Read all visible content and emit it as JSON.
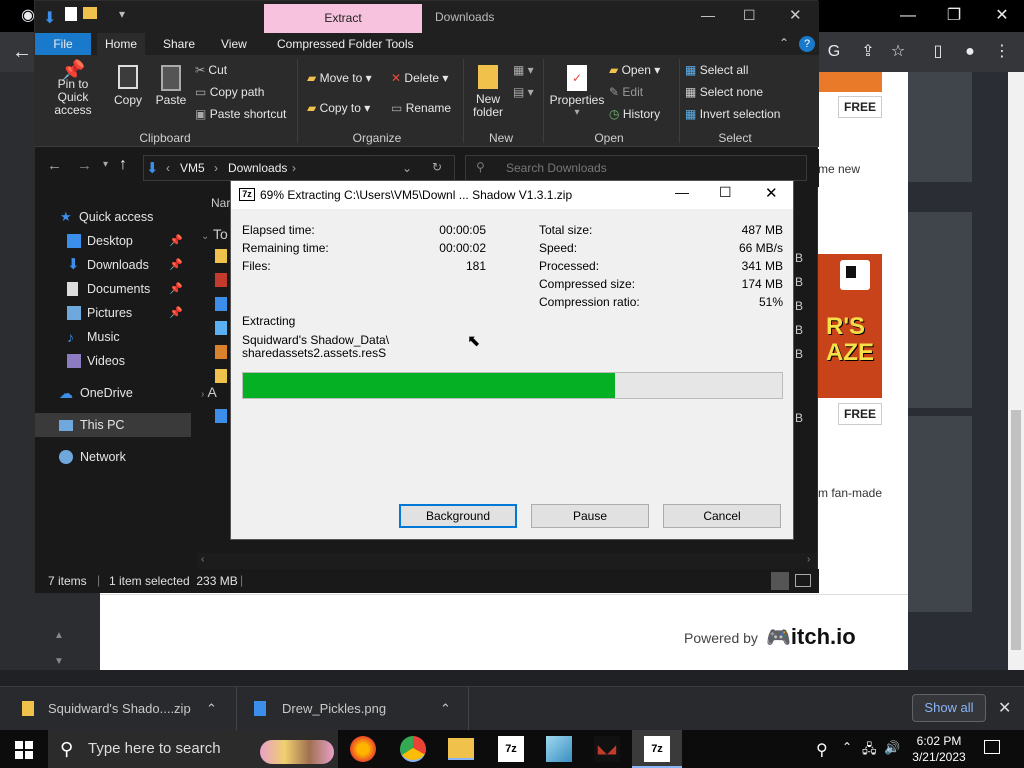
{
  "chrome": {
    "webpage": {
      "free_badge_1": "FREE",
      "free_badge_2": "FREE",
      "snippet_1": "me new",
      "snippet_2": "m fan-made",
      "game_title_art": "R'S\nAZE",
      "powered_by": "Powered by",
      "brand": "itch.io"
    }
  },
  "explorer": {
    "title_tab": "Extract",
    "title_location": "Downloads",
    "menu": [
      "File",
      "Home",
      "Share",
      "View",
      "Compressed Folder Tools"
    ],
    "ribbon": {
      "pin_label": "Pin to Quick access",
      "copy_label": "Copy",
      "paste_label": "Paste",
      "cut_label": "Cut",
      "copy_path_label": "Copy path",
      "paste_shortcut_label": "Paste shortcut",
      "move_to_label": "Move to",
      "copy_to_label": "Copy to",
      "delete_label": "Delete",
      "rename_label": "Rename",
      "new_folder_label": "New folder",
      "properties_label": "Properties",
      "open_label": "Open",
      "edit_label": "Edit",
      "history_label": "History",
      "select_all_label": "Select all",
      "select_none_label": "Select none",
      "invert_selection_label": "Invert selection",
      "groups": [
        "Clipboard",
        "Organize",
        "New",
        "Open",
        "Select"
      ]
    },
    "address": {
      "crumbs": [
        "VM5",
        "Downloads"
      ],
      "search_placeholder": "Search Downloads"
    },
    "nav": {
      "quick_access": "Quick access",
      "items": [
        {
          "label": "Desktop",
          "icon": "desktop-icon",
          "pinned": true
        },
        {
          "label": "Downloads",
          "icon": "download-icon",
          "pinned": true
        },
        {
          "label": "Documents",
          "icon": "documents-icon",
          "pinned": true
        },
        {
          "label": "Pictures",
          "icon": "pictures-icon",
          "pinned": true
        },
        {
          "label": "Music",
          "icon": "music-icon",
          "pinned": false
        },
        {
          "label": "Videos",
          "icon": "videos-icon",
          "pinned": false
        }
      ],
      "onedrive": "OneDrive",
      "this_pc": "This PC",
      "network": "Network"
    },
    "content_peek": {
      "col_header": "Nar",
      "group_1": "To",
      "group_2": "A",
      "size_suffix": "B"
    },
    "status": {
      "items_count": "7 items",
      "selection": "1 item selected  233 MB"
    }
  },
  "dialog": {
    "title": "69% Extracting C:\\Users\\VM5\\Downl ... Shadow V1.3.1.zip",
    "icon_text": "7z",
    "left_stats": [
      {
        "label": "Elapsed time:",
        "value": "00:00:05"
      },
      {
        "label": "Remaining time:",
        "value": "00:00:02"
      },
      {
        "label": "Files:",
        "value": "181"
      }
    ],
    "right_stats": [
      {
        "label": "Total size:",
        "value": "487 MB"
      },
      {
        "label": "Speed:",
        "value": "66 MB/s"
      },
      {
        "label": "Processed:",
        "value": "341 MB"
      },
      {
        "label": "Compressed size:",
        "value": "174 MB"
      },
      {
        "label": "Compression ratio:",
        "value": "51%"
      }
    ],
    "operation": "Extracting",
    "current_path_line1": "Squidward's Shadow_Data\\",
    "current_path_line2": "sharedassets2.assets.resS",
    "progress_fraction": 0.69,
    "buttons": {
      "background": "Background",
      "pause": "Pause",
      "cancel": "Cancel"
    }
  },
  "downloads_bar": {
    "items": [
      {
        "name": "Squidward's Shado....zip",
        "icon": "zip-file-icon"
      },
      {
        "name": "Drew_Pickles.png",
        "icon": "image-file-icon"
      }
    ],
    "show_all": "Show all"
  },
  "taskbar": {
    "search_placeholder": "Type here to search",
    "time": "6:02 PM",
    "date": "3/21/2023"
  },
  "colors": {
    "progress_green": "#06b025",
    "accent_blue": "#0078d7",
    "extract_tab_pink": "#f7c2dd"
  }
}
